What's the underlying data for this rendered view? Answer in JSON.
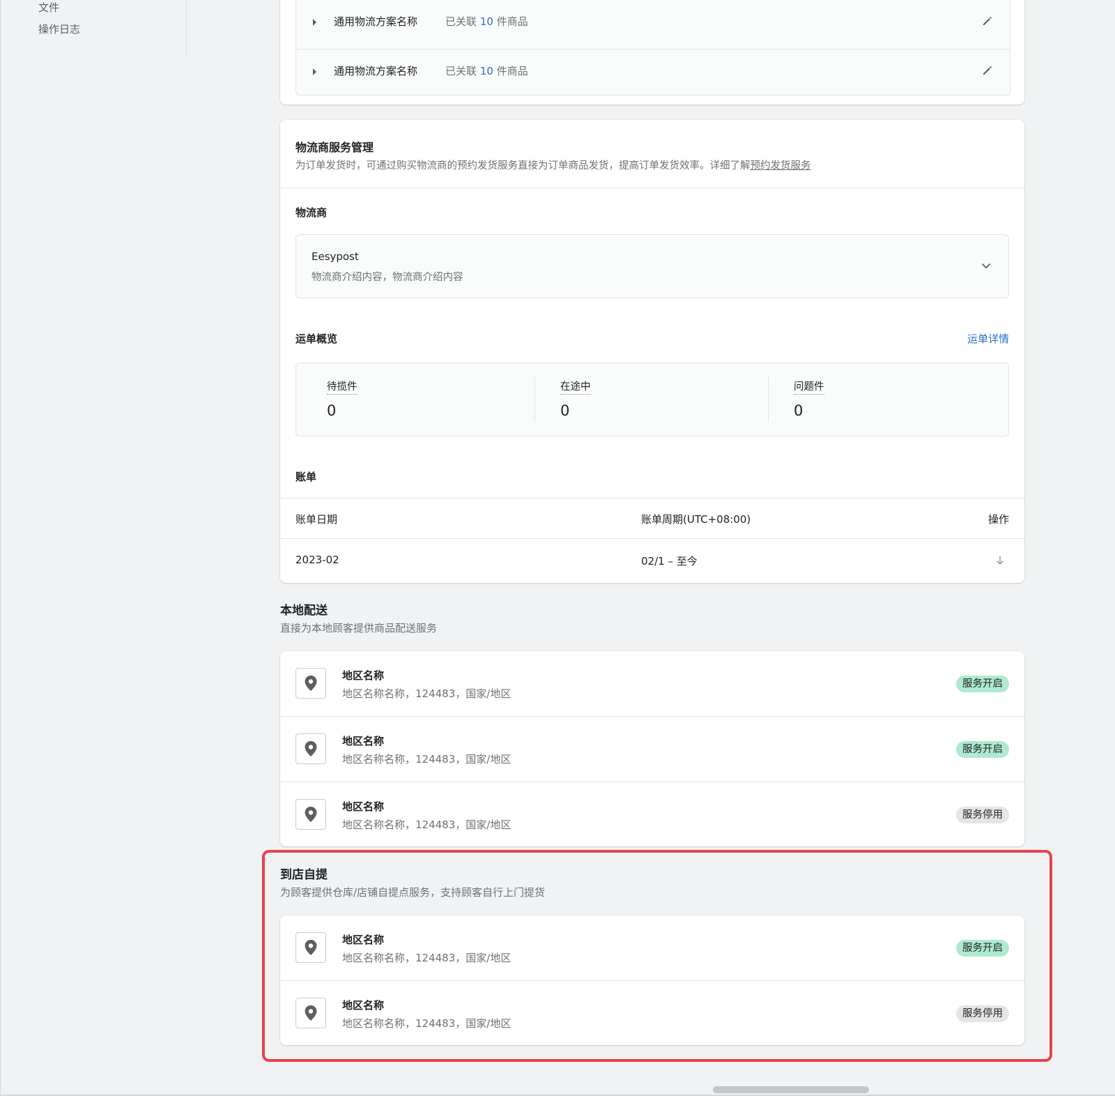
{
  "sidebar": {
    "items": [
      {
        "label": "文件"
      },
      {
        "label": "操作日志"
      }
    ]
  },
  "plans": [
    {
      "name": "通用物流方案名称",
      "linked_prefix": "已关联",
      "count": "10",
      "linked_suffix": "件商品"
    },
    {
      "name": "通用物流方案名称",
      "linked_prefix": "已关联",
      "count": "10",
      "linked_suffix": "件商品"
    }
  ],
  "logistics": {
    "title": "物流商服务管理",
    "desc": "为订单发货时，可通过购买物流商的预约发货服务直接为订单商品发货，提高订单发货效率。详细了解",
    "desc_link": "预约发货服务",
    "provider_label": "物流商",
    "provider": {
      "name": "Eesypost",
      "desc": "物流商介绍内容，物流商介绍内容"
    },
    "overview_label": "运单概览",
    "overview_link": "运单详情",
    "stats": [
      {
        "label": "待揽件",
        "value": "0"
      },
      {
        "label": "在途中",
        "value": "0"
      },
      {
        "label": "问题件",
        "value": "0"
      }
    ],
    "bill_label": "账单",
    "bill_headers": {
      "date": "账单日期",
      "period": "账单周期(UTC+08:00)",
      "action": "操作"
    },
    "bill_rows": [
      {
        "date": "2023-02",
        "period": "02/1 – 至今"
      }
    ]
  },
  "local_delivery": {
    "title": "本地配送",
    "desc": "直接为本地顾客提供商品配送服务",
    "items": [
      {
        "name": "地区名称",
        "addr": "地区名称名称，124483，国家/地区",
        "status": "服务开启",
        "on": true
      },
      {
        "name": "地区名称",
        "addr": "地区名称名称，124483，国家/地区",
        "status": "服务开启",
        "on": true
      },
      {
        "name": "地区名称",
        "addr": "地区名称名称，124483，国家/地区",
        "status": "服务停用",
        "on": false
      }
    ]
  },
  "pickup": {
    "title": "到店自提",
    "desc": "为顾客提供仓库/店铺自提点服务，支持顾客自行上门提货",
    "items": [
      {
        "name": "地区名称",
        "addr": "地区名称名称，124483，国家/地区",
        "status": "服务开启",
        "on": true
      },
      {
        "name": "地区名称",
        "addr": "地区名称名称，124483，国家/地区",
        "status": "服务停用",
        "on": false
      }
    ]
  },
  "colors": {
    "accent": "#2c6ecb",
    "badge_on": "#aee9d1",
    "badge_off": "#e4e5e7",
    "highlight": "#e9434b"
  },
  "icons": {
    "expand": "caret-right-icon",
    "edit": "pencil-icon",
    "dropdown": "chevron-down-icon",
    "download": "download-icon",
    "location": "map-pin-icon"
  }
}
